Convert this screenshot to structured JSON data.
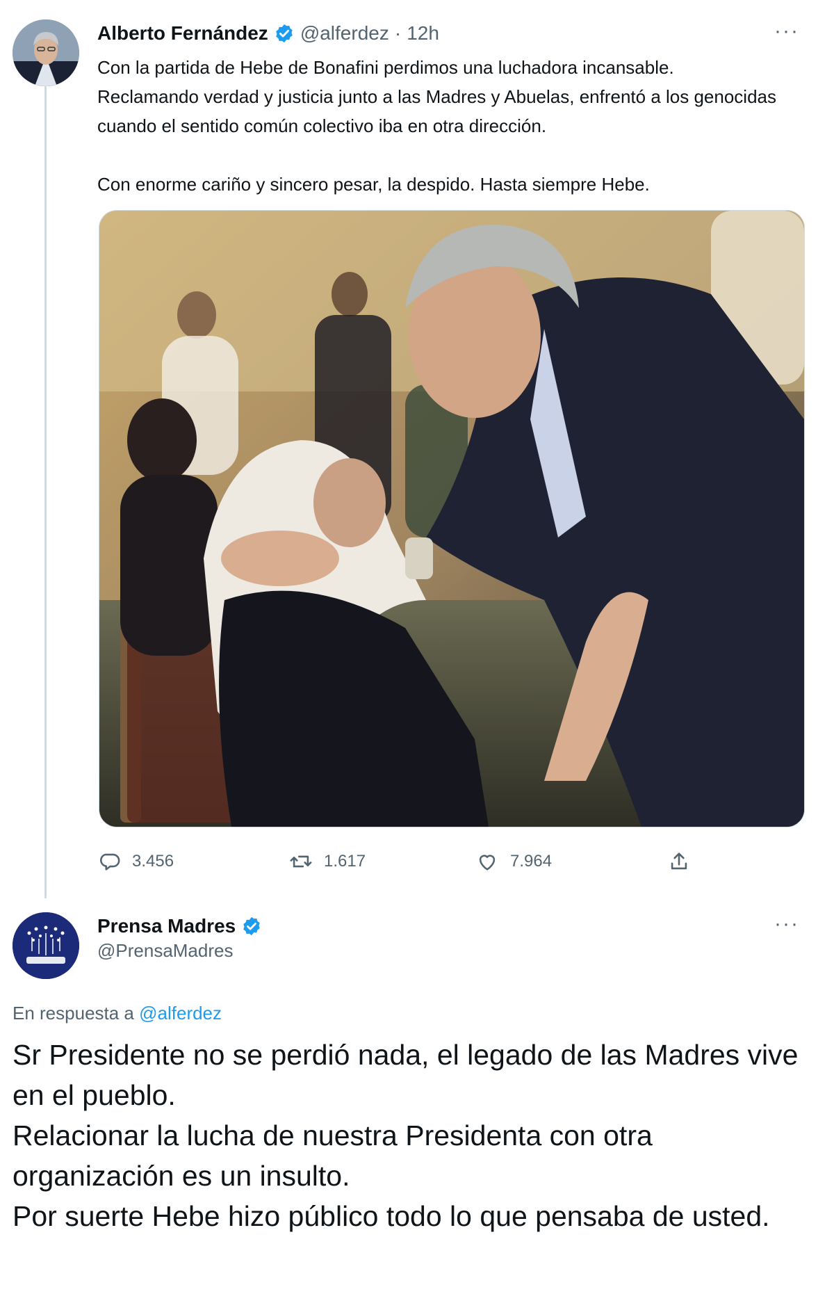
{
  "tweet": {
    "author_name": "Alberto Fernández",
    "handle": "@alferdez",
    "separator": "·",
    "time": "12h",
    "more": "···",
    "text": "Con la partida de Hebe de Bonafini perdimos una luchadora incansable.\nReclamando verdad y justicia junto a las Madres y Abuelas, enfrentó a los genocidas cuando el sentido común colectivo iba en otra dirección.\n\nCon enorme cariño y sincero pesar, la despido. Hasta siempre Hebe.",
    "stats": {
      "replies": "3.456",
      "retweets": "1.617",
      "likes": "7.964"
    }
  },
  "reply": {
    "author_name": "Prensa Madres",
    "handle": "@PrensaMadres",
    "more": "···",
    "in_reply_to_label": "En respuesta a",
    "in_reply_to_handle": "@alferdez",
    "text": "Sr Presidente no se perdió nada, el legado de las Madres vive en el pueblo.\nRelacionar la lucha de nuestra Presidenta con otra organización es un insulto.\nPor suerte Hebe hizo público todo lo que pensaba de usted."
  },
  "colors": {
    "text": "#0f1419",
    "secondary": "#536471",
    "accent": "#1d9bf0",
    "thread_line": "#cfd9de"
  },
  "icons": [
    "verified-badge-icon",
    "reply-icon",
    "retweet-icon",
    "like-icon",
    "share-icon",
    "more-icon"
  ]
}
